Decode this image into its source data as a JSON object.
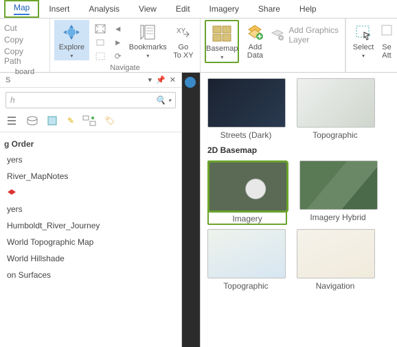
{
  "menu": {
    "map": "Map",
    "insert": "Insert",
    "analysis": "Analysis",
    "view": "View",
    "edit": "Edit",
    "imagery": "Imagery",
    "share": "Share",
    "help": "Help"
  },
  "clipboard": {
    "cut": "Cut",
    "copy": "Copy",
    "copypath": "Copy Path",
    "group": "board"
  },
  "navigate": {
    "explore": "Explore",
    "bookmarks": "Bookmarks",
    "gotoxy": "Go\nTo XY",
    "group": "Navigate"
  },
  "layer": {
    "basemap": "Basemap",
    "adddata": "Add\nData",
    "addgraphics": "Add Graphics Layer"
  },
  "selection": {
    "select": "Select",
    "selattr": "Se\nAtt"
  },
  "panel": {
    "title": "S",
    "search_placeholder": "h",
    "heading": "g Order",
    "items": [
      "yers",
      "River_MapNotes",
      "",
      "yers",
      "Humboldt_River_Journey",
      "World Topographic Map",
      "World Hillshade",
      "on Surfaces"
    ]
  },
  "dropdown": {
    "row1": [
      {
        "label": "Streets (Dark)"
      },
      {
        "label": "Topographic"
      }
    ],
    "section": "2D Basemap",
    "row2": [
      {
        "label": "Imagery"
      },
      {
        "label": "Imagery Hybrid"
      }
    ],
    "row3": [
      {
        "label": "Topographic"
      },
      {
        "label": "Navigation"
      }
    ]
  }
}
